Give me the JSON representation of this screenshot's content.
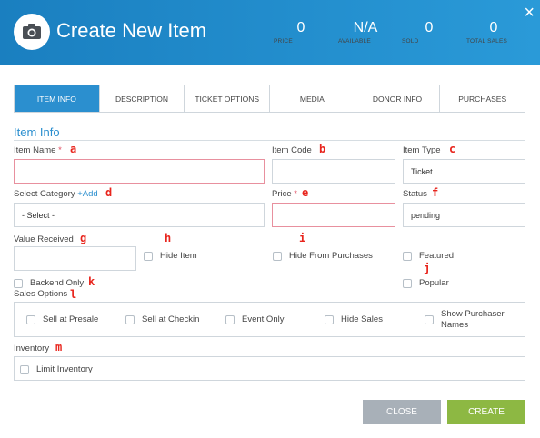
{
  "header": {
    "title": "Create New Item",
    "stats": [
      {
        "value": "0",
        "label": "PRICE"
      },
      {
        "value": "N/A",
        "label": "AVAILABLE"
      },
      {
        "value": "0",
        "label": "SOLD"
      },
      {
        "value": "0",
        "label": "TOTAL SALES"
      }
    ],
    "close_glyph": "×",
    "icon": "camera-icon"
  },
  "tabs": [
    {
      "label": "ITEM INFO",
      "active": true
    },
    {
      "label": "DESCRIPTION"
    },
    {
      "label": "TICKET OPTIONS"
    },
    {
      "label": "MEDIA"
    },
    {
      "label": "DONOR INFO"
    },
    {
      "label": "PURCHASES"
    }
  ],
  "section_title": "Item Info",
  "fields": {
    "item_name": {
      "label": "Item Name",
      "required_mark": "*",
      "value": "",
      "annotation": "a"
    },
    "item_code": {
      "label": "Item Code",
      "value": "",
      "annotation": "b"
    },
    "item_type": {
      "label": "Item Type",
      "value": "Ticket",
      "annotation": "c"
    },
    "category": {
      "label": "Select Category",
      "add_label": "+Add",
      "value": "- Select -",
      "annotation": "d"
    },
    "price": {
      "label": "Price",
      "required_mark": "*",
      "value": "",
      "annotation": "e"
    },
    "status": {
      "label": "Status",
      "value": "pending",
      "annotation": "f"
    },
    "value_received": {
      "label": "Value Received",
      "value": "",
      "annotation": "g"
    }
  },
  "checkboxes": {
    "hide_item": {
      "label": "Hide Item",
      "annotation": "h"
    },
    "hide_from_purchases": {
      "label": "Hide From Purchases",
      "annotation": "i"
    },
    "featured": {
      "label": "Featured",
      "annotation": "j"
    },
    "popular": {
      "label": "Popular"
    },
    "backend_only": {
      "label": "Backend Only",
      "annotation": "k"
    }
  },
  "sales_options": {
    "label": "Sales Options",
    "annotation": "l",
    "items": [
      "Sell at Presale",
      "Sell at Checkin",
      "Event Only",
      "Hide Sales",
      "Show Purchaser Names"
    ]
  },
  "inventory": {
    "label": "Inventory",
    "annotation": "m",
    "limit_label": "Limit Inventory"
  },
  "buttons": {
    "close": "CLOSE",
    "create": "CREATE"
  },
  "colors": {
    "header": "#2a9ad8",
    "accent": "#2b8fcf",
    "create": "#8db843",
    "close": "#a8b0b8",
    "annotation": "#e8251d"
  }
}
